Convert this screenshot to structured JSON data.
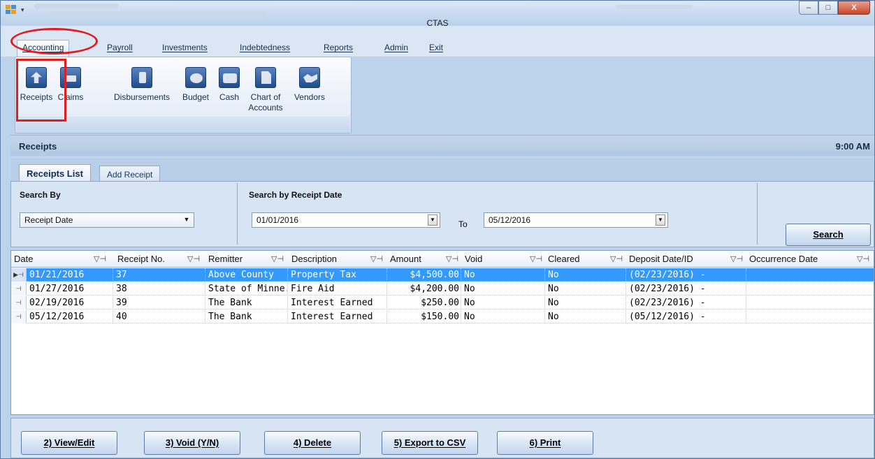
{
  "window": {
    "title": "CTAS",
    "minimize": "–",
    "maximize": "□",
    "close": "X"
  },
  "menu": {
    "items": [
      "Accounting",
      "Payroll",
      "Investments",
      "Indebtedness",
      "Reports",
      "Admin",
      "Exit"
    ]
  },
  "ribbon": {
    "buttons": [
      {
        "label": "Receipts",
        "icon": "receipts-arrow-icon"
      },
      {
        "label": "Claims",
        "icon": "claims-icon"
      },
      {
        "label": "Disbursements",
        "icon": "disbursements-icon"
      },
      {
        "label": "Budget",
        "icon": "piggy-bank-icon"
      },
      {
        "label": "Cash",
        "icon": "cash-icon"
      },
      {
        "label": "Chart of",
        "label2": "Accounts",
        "icon": "chart-of-accounts-icon"
      },
      {
        "label": "Vendors",
        "icon": "handshake-icon"
      }
    ]
  },
  "section": {
    "title": "Receipts",
    "clock": "9:00 AM"
  },
  "tabs": {
    "active": "Receipts List",
    "inactive": "Add Receipt"
  },
  "search": {
    "by_label": "Search By",
    "by_value": "Receipt Date",
    "date_label": "Search by Receipt Date",
    "from_date": "01/01/2016",
    "to_label": "To",
    "to_date": "05/12/2016",
    "button": "Search"
  },
  "grid": {
    "columns": [
      "Date",
      "Receipt No.",
      "Remitter",
      "Description",
      "Amount",
      "Void",
      "Cleared",
      "Deposit Date/ID",
      "Occurrence Date"
    ],
    "rows": [
      {
        "date": "01/21/2016",
        "no": "37",
        "remitter": "Above County",
        "desc": "Property Tax",
        "amount": "$4,500.00",
        "void": "No",
        "cleared": "No",
        "deposit": "(02/23/2016) -",
        "occ": "",
        "selected": true
      },
      {
        "date": "01/27/2016",
        "no": "38",
        "remitter": "State of Minne...",
        "desc": "Fire Aid",
        "amount": "$4,200.00",
        "void": "No",
        "cleared": "No",
        "deposit": "(02/23/2016) -",
        "occ": "",
        "selected": false
      },
      {
        "date": "02/19/2016",
        "no": "39",
        "remitter": "The Bank",
        "desc": "Interest Earned",
        "amount": "$250.00",
        "void": "No",
        "cleared": "No",
        "deposit": "(02/23/2016) -",
        "occ": "",
        "selected": false
      },
      {
        "date": "05/12/2016",
        "no": "40",
        "remitter": "The Bank",
        "desc": "Interest Earned",
        "amount": "$150.00",
        "void": "No",
        "cleared": "No",
        "deposit": "(05/12/2016) -",
        "occ": "",
        "selected": false
      }
    ]
  },
  "footer": {
    "buttons": [
      "2) View/Edit",
      "3) Void (Y/N)",
      "4) Delete",
      "5) Export to CSV",
      "6) Print"
    ]
  },
  "colors": {
    "accent_red": "#e21d1d",
    "selection": "#3399ff",
    "panel": "#d7e4f4"
  }
}
